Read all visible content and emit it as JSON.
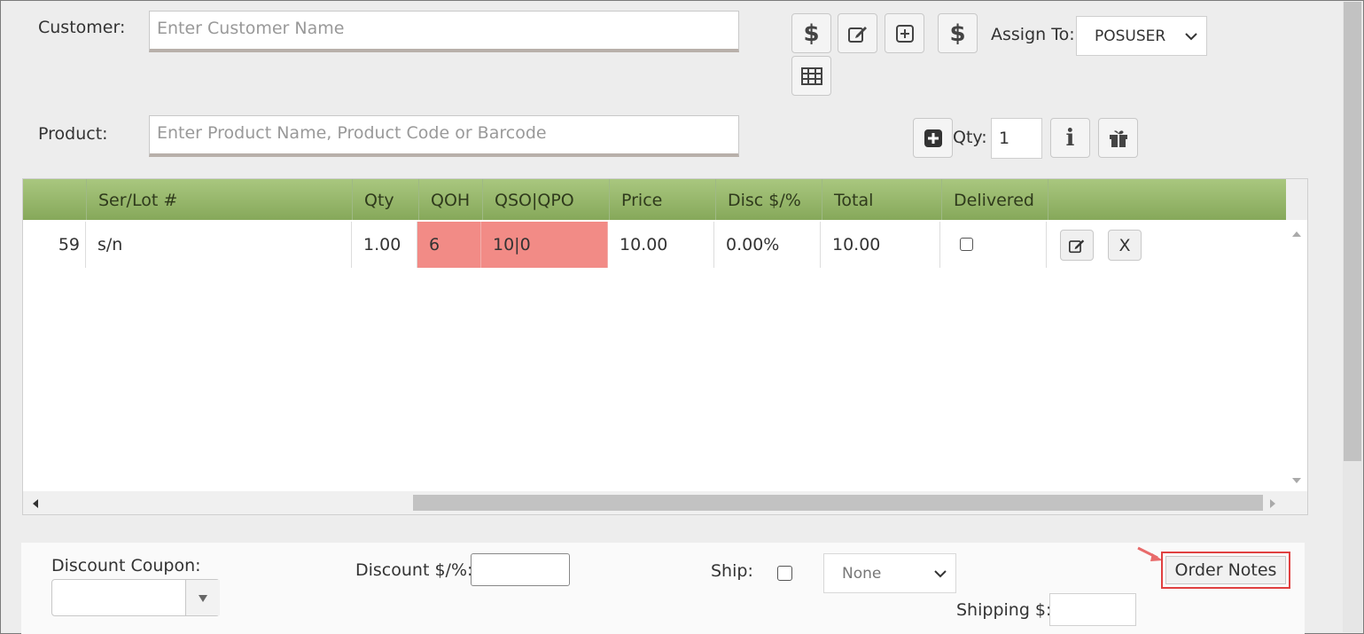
{
  "customer": {
    "label": "Customer:",
    "placeholder": "Enter Customer Name"
  },
  "product": {
    "label": "Product:",
    "placeholder": "Enter Product Name, Product Code or Barcode"
  },
  "toolbar": {
    "assign_label": "Assign To:",
    "assign_value": "POSUSER",
    "dollar": "$",
    "qty_label": "Qty:",
    "qty_value": "1",
    "info": "i"
  },
  "grid": {
    "columns": [
      "Ser/Lot #",
      "Qty",
      "QOH",
      "QSO|QPO",
      "Price",
      "Disc $/%",
      "Total",
      "Delivered"
    ],
    "row": {
      "partial": "59",
      "serlot": "s/n",
      "qty": "1.00",
      "qoh": "6",
      "qso_qpo": "10|0",
      "price": "10.00",
      "disc": "0.00%",
      "total": "10.00",
      "delete": "X"
    }
  },
  "footer": {
    "coupon_label": "Discount Coupon:",
    "discount_label": "Discount $/%:",
    "ship_label": "Ship:",
    "ship_method": "None",
    "shipping_label": "Shipping $:",
    "order_notes": "Order Notes"
  },
  "colors": {
    "header_green": "#8aad5e",
    "stock_alert": "#f28b86",
    "highlight_red": "#e04040"
  }
}
